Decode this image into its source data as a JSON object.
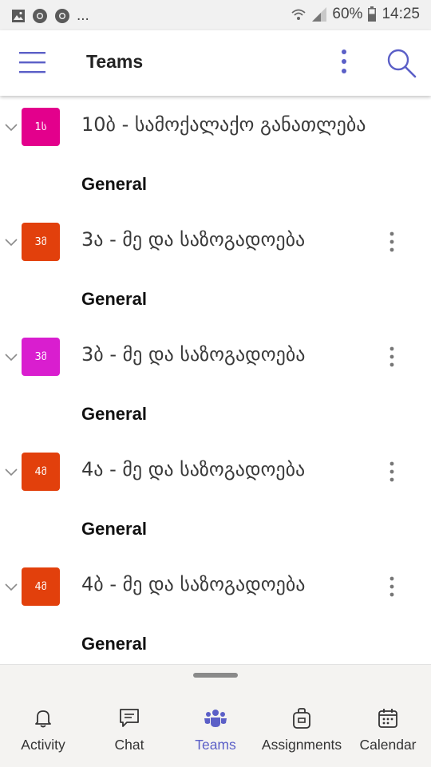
{
  "status_bar": {
    "battery": "60%",
    "time": "14:25",
    "more": "..."
  },
  "header": {
    "title": "Teams"
  },
  "teams": [
    {
      "avatar_text": "1ს",
      "avatar_color": "#e3008c",
      "name": "10ბ - სამოქალაქო განათლება",
      "channel": "General",
      "has_more": false
    },
    {
      "avatar_text": "3მ",
      "avatar_color": "#e2400c",
      "name": "3ა - მე და საზოგადოება",
      "channel": "General",
      "has_more": true
    },
    {
      "avatar_text": "3მ",
      "avatar_color": "#d91ecf",
      "name": "3ბ - მე და საზოგადოება",
      "channel": "General",
      "has_more": true
    },
    {
      "avatar_text": "4მ",
      "avatar_color": "#e2400c",
      "name": "4ა - მე და საზოგადოება",
      "channel": "General",
      "has_more": true
    },
    {
      "avatar_text": "4მ",
      "avatar_color": "#e2400c",
      "name": "4ბ - მე და საზოგადოება",
      "channel": "General",
      "has_more": true
    }
  ],
  "nav": {
    "active_color": "#5b5fc7",
    "items": [
      {
        "label": "Activity",
        "icon": "bell-icon"
      },
      {
        "label": "Chat",
        "icon": "chat-icon"
      },
      {
        "label": "Teams",
        "icon": "teams-icon",
        "active": true
      },
      {
        "label": "Assignments",
        "icon": "bag-icon"
      },
      {
        "label": "Calendar",
        "icon": "calendar-icon"
      }
    ]
  }
}
